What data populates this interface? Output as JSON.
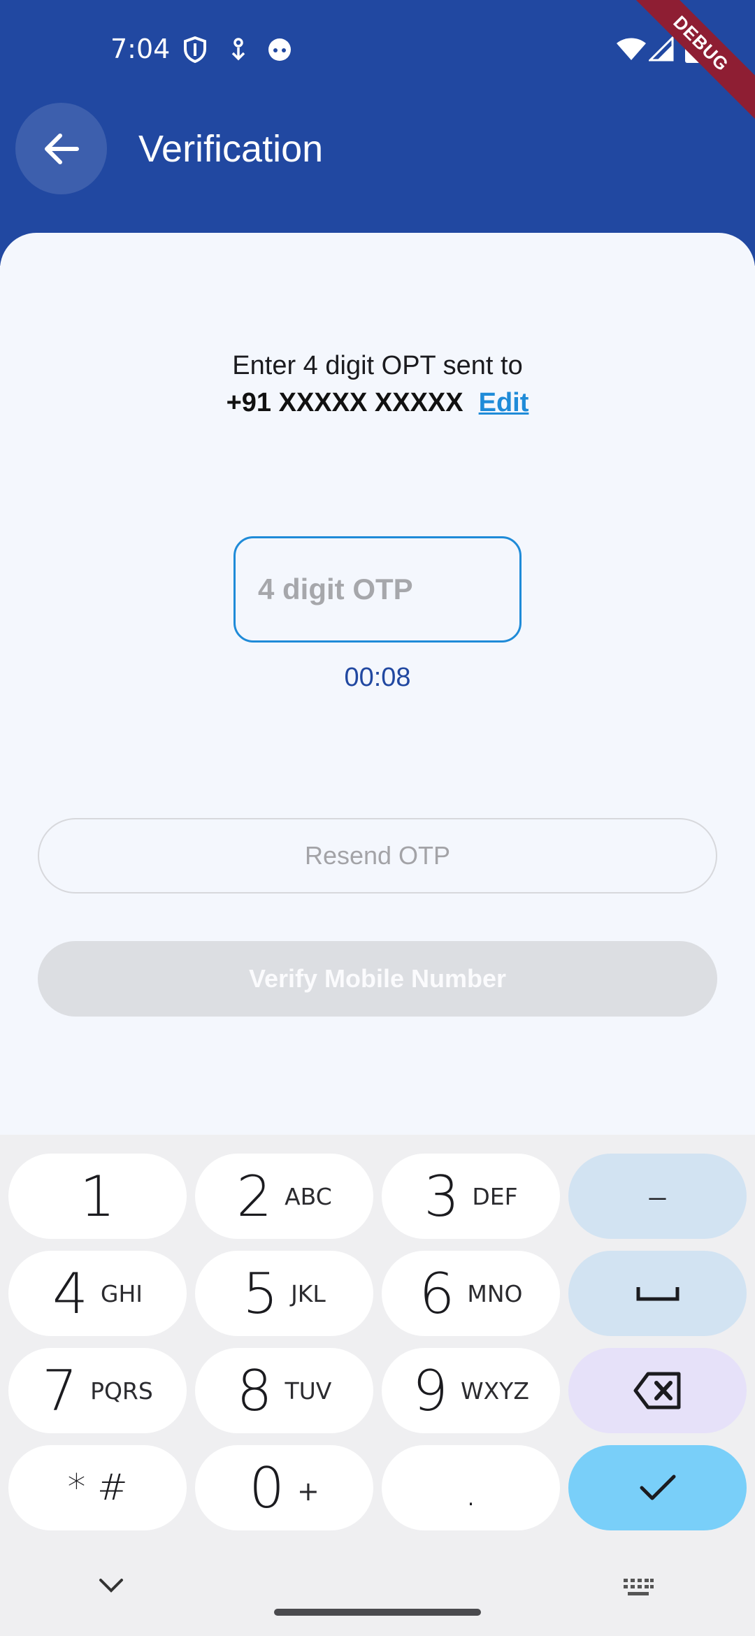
{
  "status_bar": {
    "time": "7:04",
    "debug_label": "DEBUG"
  },
  "appbar": {
    "title": "Verification"
  },
  "verification": {
    "prompt": "Enter 4 digit OPT sent to",
    "phone": "+91 XXXXX XXXXX",
    "edit_label": "Edit",
    "otp_placeholder": "4 digit OTP",
    "timer": "00:08",
    "resend_label": "Resend OTP",
    "verify_label": "Verify Mobile Number"
  },
  "keyboard": {
    "keys": [
      {
        "num": "1",
        "letters": ""
      },
      {
        "num": "2",
        "letters": "ABC"
      },
      {
        "num": "3",
        "letters": "DEF"
      },
      {
        "num": "4",
        "letters": "GHI"
      },
      {
        "num": "5",
        "letters": "JKL"
      },
      {
        "num": "6",
        "letters": "MNO"
      },
      {
        "num": "7",
        "letters": "PQRS"
      },
      {
        "num": "8",
        "letters": "TUV"
      },
      {
        "num": "9",
        "letters": "WXYZ"
      },
      {
        "num": "* #",
        "letters": ""
      },
      {
        "num": "0",
        "letters": "+"
      },
      {
        "num": ".",
        "letters": ""
      }
    ],
    "dash_label": "–"
  },
  "colors": {
    "primary": "#2148a1",
    "link": "#1f8bd8",
    "done_key": "#79cff9"
  }
}
